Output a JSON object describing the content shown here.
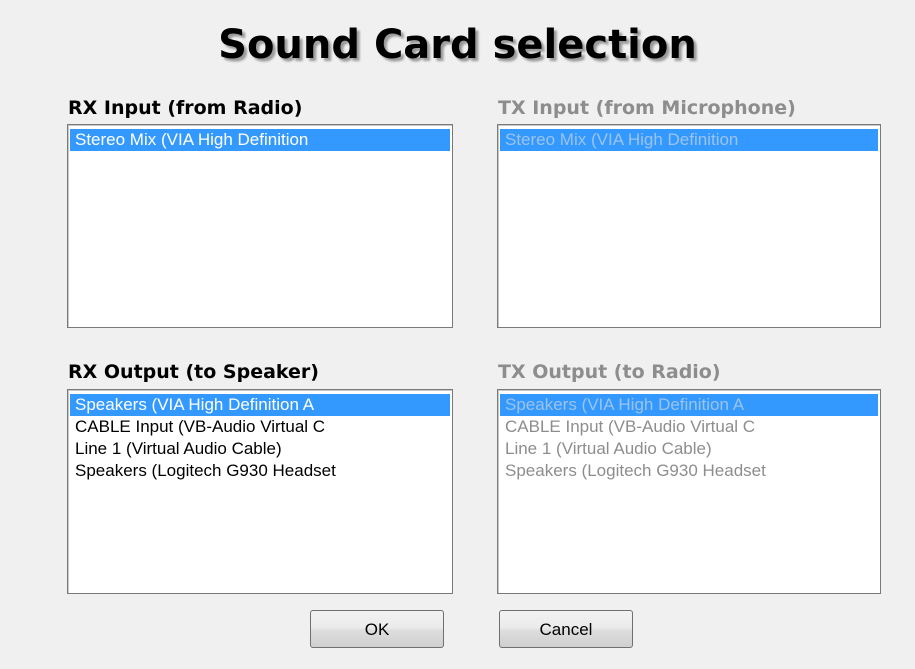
{
  "dialog": {
    "title": "Sound Card selection"
  },
  "rx_input": {
    "label": "RX Input (from Radio)",
    "enabled": true,
    "items": [
      "Stereo Mix (VIA High Definition"
    ],
    "selected_index": 0
  },
  "tx_input": {
    "label": "TX Input (from Microphone)",
    "enabled": false,
    "items": [
      "Stereo Mix (VIA High Definition"
    ],
    "selected_index": 0
  },
  "rx_output": {
    "label": "RX Output (to Speaker)",
    "enabled": true,
    "items": [
      "Speakers (VIA High Definition A",
      "CABLE Input (VB-Audio Virtual C",
      "Line 1 (Virtual Audio Cable)",
      "Speakers (Logitech G930 Headset"
    ],
    "selected_index": 0
  },
  "tx_output": {
    "label": "TX Output (to Radio)",
    "enabled": false,
    "items": [
      "Speakers (VIA High Definition A",
      "CABLE Input (VB-Audio Virtual C",
      "Line 1 (Virtual Audio Cable)",
      "Speakers (Logitech G930 Headset"
    ],
    "selected_index": 0
  },
  "buttons": {
    "ok_label": "OK",
    "cancel_label": "Cancel"
  },
  "colors": {
    "selection": "#3399ff",
    "disabled_text": "#8d8d8d",
    "background": "#f0f0f0"
  }
}
